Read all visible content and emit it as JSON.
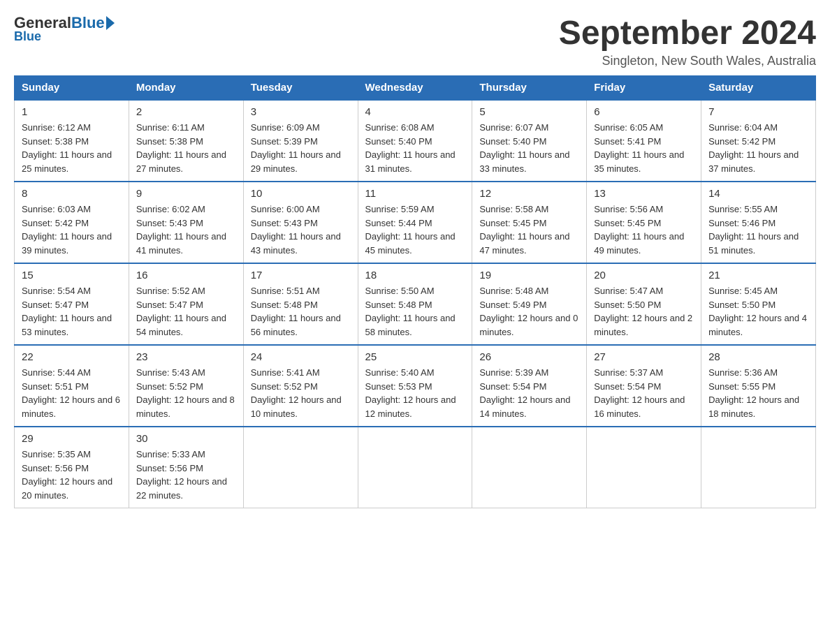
{
  "header": {
    "logo_general": "General",
    "logo_blue": "Blue",
    "month_title": "September 2024",
    "location": "Singleton, New South Wales, Australia"
  },
  "days_of_week": [
    "Sunday",
    "Monday",
    "Tuesday",
    "Wednesday",
    "Thursday",
    "Friday",
    "Saturday"
  ],
  "weeks": [
    [
      {
        "day": "1",
        "sunrise": "6:12 AM",
        "sunset": "5:38 PM",
        "daylight": "11 hours and 25 minutes."
      },
      {
        "day": "2",
        "sunrise": "6:11 AM",
        "sunset": "5:38 PM",
        "daylight": "11 hours and 27 minutes."
      },
      {
        "day": "3",
        "sunrise": "6:09 AM",
        "sunset": "5:39 PM",
        "daylight": "11 hours and 29 minutes."
      },
      {
        "day": "4",
        "sunrise": "6:08 AM",
        "sunset": "5:40 PM",
        "daylight": "11 hours and 31 minutes."
      },
      {
        "day": "5",
        "sunrise": "6:07 AM",
        "sunset": "5:40 PM",
        "daylight": "11 hours and 33 minutes."
      },
      {
        "day": "6",
        "sunrise": "6:05 AM",
        "sunset": "5:41 PM",
        "daylight": "11 hours and 35 minutes."
      },
      {
        "day": "7",
        "sunrise": "6:04 AM",
        "sunset": "5:42 PM",
        "daylight": "11 hours and 37 minutes."
      }
    ],
    [
      {
        "day": "8",
        "sunrise": "6:03 AM",
        "sunset": "5:42 PM",
        "daylight": "11 hours and 39 minutes."
      },
      {
        "day": "9",
        "sunrise": "6:02 AM",
        "sunset": "5:43 PM",
        "daylight": "11 hours and 41 minutes."
      },
      {
        "day": "10",
        "sunrise": "6:00 AM",
        "sunset": "5:43 PM",
        "daylight": "11 hours and 43 minutes."
      },
      {
        "day": "11",
        "sunrise": "5:59 AM",
        "sunset": "5:44 PM",
        "daylight": "11 hours and 45 minutes."
      },
      {
        "day": "12",
        "sunrise": "5:58 AM",
        "sunset": "5:45 PM",
        "daylight": "11 hours and 47 minutes."
      },
      {
        "day": "13",
        "sunrise": "5:56 AM",
        "sunset": "5:45 PM",
        "daylight": "11 hours and 49 minutes."
      },
      {
        "day": "14",
        "sunrise": "5:55 AM",
        "sunset": "5:46 PM",
        "daylight": "11 hours and 51 minutes."
      }
    ],
    [
      {
        "day": "15",
        "sunrise": "5:54 AM",
        "sunset": "5:47 PM",
        "daylight": "11 hours and 53 minutes."
      },
      {
        "day": "16",
        "sunrise": "5:52 AM",
        "sunset": "5:47 PM",
        "daylight": "11 hours and 54 minutes."
      },
      {
        "day": "17",
        "sunrise": "5:51 AM",
        "sunset": "5:48 PM",
        "daylight": "11 hours and 56 minutes."
      },
      {
        "day": "18",
        "sunrise": "5:50 AM",
        "sunset": "5:48 PM",
        "daylight": "11 hours and 58 minutes."
      },
      {
        "day": "19",
        "sunrise": "5:48 AM",
        "sunset": "5:49 PM",
        "daylight": "12 hours and 0 minutes."
      },
      {
        "day": "20",
        "sunrise": "5:47 AM",
        "sunset": "5:50 PM",
        "daylight": "12 hours and 2 minutes."
      },
      {
        "day": "21",
        "sunrise": "5:45 AM",
        "sunset": "5:50 PM",
        "daylight": "12 hours and 4 minutes."
      }
    ],
    [
      {
        "day": "22",
        "sunrise": "5:44 AM",
        "sunset": "5:51 PM",
        "daylight": "12 hours and 6 minutes."
      },
      {
        "day": "23",
        "sunrise": "5:43 AM",
        "sunset": "5:52 PM",
        "daylight": "12 hours and 8 minutes."
      },
      {
        "day": "24",
        "sunrise": "5:41 AM",
        "sunset": "5:52 PM",
        "daylight": "12 hours and 10 minutes."
      },
      {
        "day": "25",
        "sunrise": "5:40 AM",
        "sunset": "5:53 PM",
        "daylight": "12 hours and 12 minutes."
      },
      {
        "day": "26",
        "sunrise": "5:39 AM",
        "sunset": "5:54 PM",
        "daylight": "12 hours and 14 minutes."
      },
      {
        "day": "27",
        "sunrise": "5:37 AM",
        "sunset": "5:54 PM",
        "daylight": "12 hours and 16 minutes."
      },
      {
        "day": "28",
        "sunrise": "5:36 AM",
        "sunset": "5:55 PM",
        "daylight": "12 hours and 18 minutes."
      }
    ],
    [
      {
        "day": "29",
        "sunrise": "5:35 AM",
        "sunset": "5:56 PM",
        "daylight": "12 hours and 20 minutes."
      },
      {
        "day": "30",
        "sunrise": "5:33 AM",
        "sunset": "5:56 PM",
        "daylight": "12 hours and 22 minutes."
      },
      null,
      null,
      null,
      null,
      null
    ]
  ]
}
